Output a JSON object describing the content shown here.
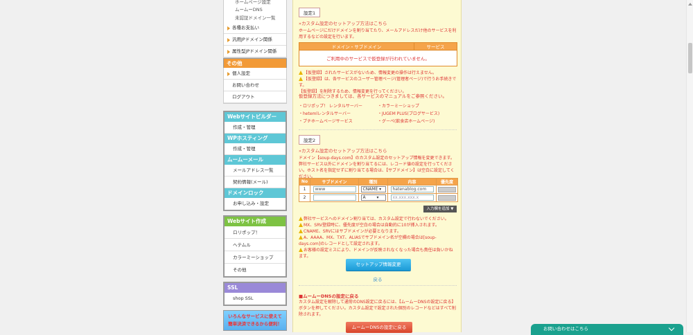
{
  "sidebar": {
    "top_items": [
      "ホームページ設定",
      "ムームーDNS",
      "未認証ドメイン一覧"
    ],
    "group1": [
      "各種お支払い",
      "汎用JPドメイン関係",
      "属性型JPドメイン関係"
    ],
    "sonota_head": "その他",
    "group2": [
      "個人設定",
      "お問い合わせ",
      "ログアウト"
    ],
    "builder_head": "Webサイトビルダー",
    "builder_item": "作成・管理",
    "wp_head": "WPホスティング",
    "wp_item": "作成・管理",
    "mail_head": "ムームーメール",
    "mail_items": [
      "メールアドレス一覧",
      "契約情報(メール)"
    ],
    "lock_head": "ドメインロック",
    "lock_item": "お申し込み・設定",
    "web_head": "Webサイト作成",
    "web_items": [
      "ロリポップ！",
      "ヘテムル",
      "カラーミーショップ",
      "その他"
    ],
    "ssl_head": "SSL",
    "ssl_item": "shop SSL",
    "banner": "いろんなサービスに使えて\n簡単決済できるから便利！"
  },
  "main": {
    "s1_tag": "設定1",
    "s1_link": "»カスタム設定のセットアップ方法はこちら",
    "s1_desc": "ホームページにだけドメインを割り当てたり、メールアドレスだけ他のサービスを利用するなどの設定を行います。",
    "t1_headers": [
      "ドメイン・サブドメイン",
      "サービス"
    ],
    "t1_empty": "ご利用中のサービスで仮登録が行われていません。",
    "s1_notes": [
      "【仮登録】されたサービスがないため、情報変更の操作は行えません。",
      "【仮登録】は、各サービスのユーザー管理ページ(管理者ページ)で行うお手続きです。",
      "【仮登録】を削除するため、情報変更を行ってください。"
    ],
    "s1_manual": "仮登録方法につきましては、各サービスのマニュアルをご参照ください。",
    "services": [
      "・ロリポップ！ レンタルサーバー",
      "・カラーミーショップ",
      "・hetemlレンタルサーバー",
      "・JUGEM PLUS(ブログサービス)",
      "・プチホームページサービス",
      "・グーペ(飲食店ホームページ)"
    ],
    "s2_tag": "設定2",
    "s2_link": "»カスタム設定のセットアップ方法はこちら",
    "s2_desc": "ドメイン【soup-days.com】のカスタム設定のセットアップ情報を変更できます。弊社サービス以外にドメインを割り当てるには、レコード値の設定を行ってください。ホスト名を指定せずに割り当てる場合は、【サブドメイン】は空白に設定してください。",
    "t2_headers": [
      "No",
      "サブドメイン",
      "種別",
      "内容",
      "優先度"
    ],
    "rows": [
      {
        "no": "1",
        "sub": "www",
        "type": "CNAME",
        "content": "hatenablog.com"
      },
      {
        "no": "2",
        "sub": "",
        "type": "A",
        "content": "xx.xxx.xxx.x"
      }
    ],
    "add_btn": "入力欄を追加 ▼",
    "s2_notes": [
      "弊社サービスへのドメイン割り当ては、カスタム設定で行わないでください。",
      "MX、SRV登録時に、優先度が空白の場合は自動的に10が挿入されます。",
      "CNAME、SRVにはサブドメインが必要となります。",
      "A、AAAA、MX、TXT、ALIASでサブドメイン名が空欄の場合は[soup-days.com]のレコードとして設定されます。",
      "お客様の設定ミスにより、ドメインが反映されなくなった場合も責任は負いかねます。"
    ],
    "submit": "セットアップ情報変更",
    "back": "戻る",
    "dns_head": "■ムームーDNSの設定に戻る",
    "dns_desc": "カスタム設定を解除して通常のDNS設定に戻るには、【ムームーDNSの設定に戻る】ボタンを押してください。カスタム設定で設定された個別のレコードなどはすべて削除されます。",
    "dns_btn": "ムームーDNSの設定に戻る"
  },
  "chat": {
    "label": "お問い合わせはこちら"
  }
}
